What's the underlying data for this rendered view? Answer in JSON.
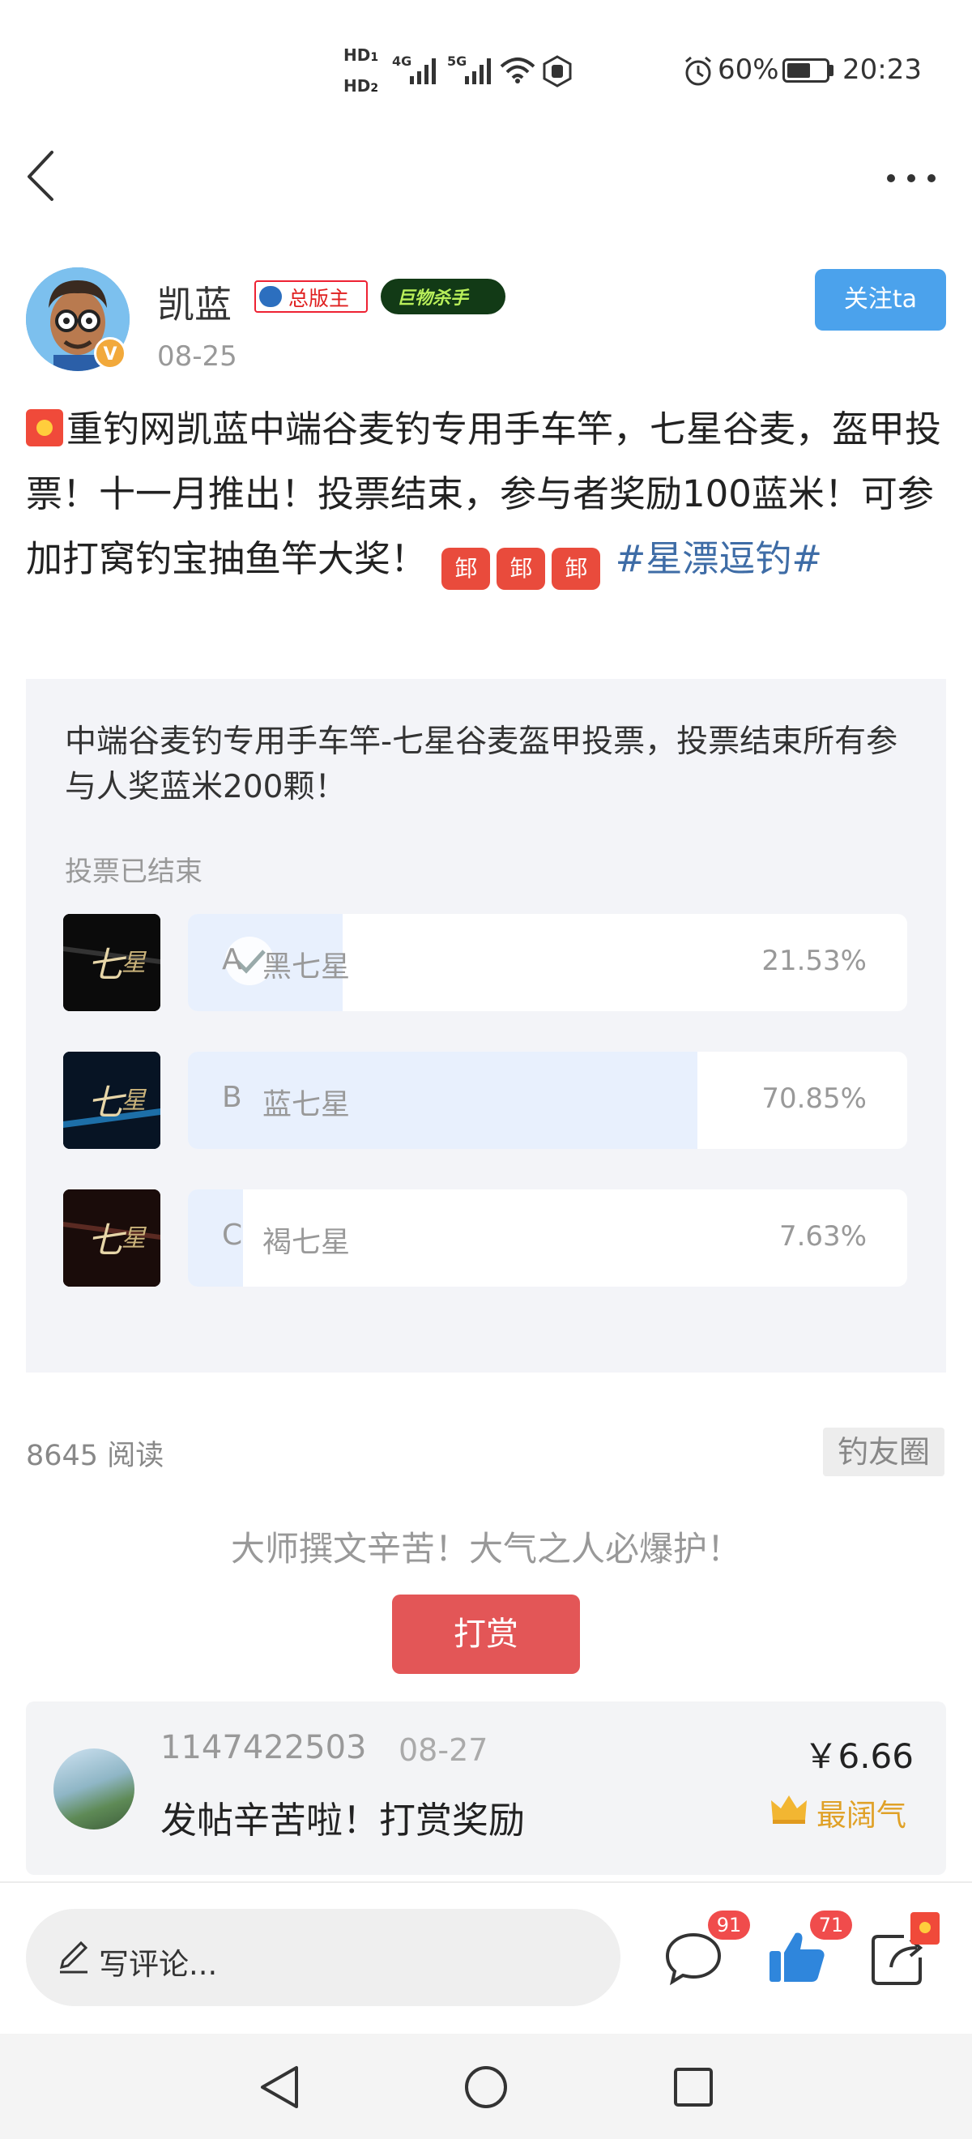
{
  "status_bar": {
    "hd1": "HD",
    "hd1_sub": "1",
    "hd2": "HD",
    "hd2_sub": "2",
    "net1": "4G",
    "net2": "5G",
    "battery": "60%",
    "time": "20:23",
    "battery_level": 0.6
  },
  "post": {
    "author": "凯蓝",
    "badge_moderator": "总版主",
    "badge_killer": "巨物杀手",
    "date": "08-25",
    "follow_label": "关注ta",
    "body": "重钓网凯蓝中端谷麦钓专用手车竿，七星谷麦，盔甲投票！十一月推出！投票结束，参与者奖励100蓝米！可参加打窝钓宝抽鱼竿大奖！",
    "emoji_label": "䣃",
    "hashtag": "#星漂逗钓#"
  },
  "vote": {
    "title": "中端谷麦钓专用手车竿-七星谷麦盔甲投票，投票结束所有参与人奖蓝米200颗！",
    "status": "投票已结束",
    "options": [
      {
        "letter": "A",
        "name": "黑七星",
        "percent_label": "21.53%",
        "percent": 21.53,
        "voted": true
      },
      {
        "letter": "B",
        "name": "蓝七星",
        "percent_label": "70.85%",
        "percent": 70.85,
        "voted": false
      },
      {
        "letter": "C",
        "name": "褐七星",
        "percent_label": "7.63%",
        "percent": 7.63,
        "voted": false
      }
    ]
  },
  "meta": {
    "read_count": "8645 阅读",
    "circle": "钓友圈",
    "reward_slogan": "大师撰文辛苦！大气之人必爆护！",
    "reward_button": "打赏"
  },
  "reward_record": {
    "user": "1147422503",
    "date": "08-27",
    "message": "发帖辛苦啦！打赏奖励",
    "amount": "￥6.66",
    "tag": "最阔气"
  },
  "bottom_bar": {
    "comment_placeholder": "写评论...",
    "comment_count": "91",
    "like_count": "71"
  },
  "colors": {
    "accent_blue": "#4ba2ec",
    "reward_red": "#e35657",
    "vote_fill": "#e8f0fd",
    "gold": "#e0a127"
  }
}
